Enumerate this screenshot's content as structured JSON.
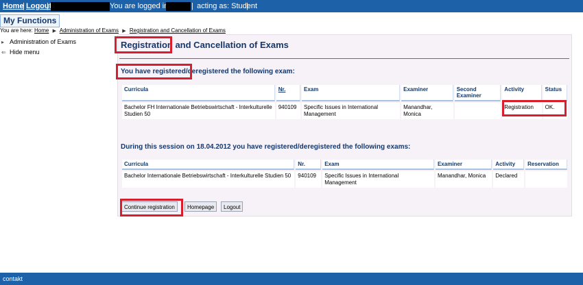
{
  "topbar": {
    "home": "Home",
    "logout": "Logout",
    "logged_in_text": "You are logged in as",
    "acting_as": "acting as: Student"
  },
  "my_functions": "My Functions",
  "breadcrumb": {
    "prefix": "You are here:",
    "items": [
      "Home",
      "Administration of Exams",
      "Registration and Cancellation of Exams"
    ]
  },
  "sidebar": {
    "items": [
      {
        "label": "Administration of Exams",
        "icon": "triangle-right-icon"
      },
      {
        "label": "Hide menu",
        "icon": "arrow-left-icon"
      }
    ]
  },
  "main": {
    "title": "Registration and Cancellation of Exams",
    "confirmation": "You have registered/deregistered the following exam:",
    "session_heading": "During this session on 18.04.2012 you have registered/deregistered the following exams:"
  },
  "table1": {
    "headers": [
      "Curricula",
      "Nr.",
      "Exam",
      "Examiner",
      "Second Examiner",
      "Activity",
      "Status"
    ],
    "row": {
      "curricula": "Bachelor FH Internationale Betriebswirtschaft - Interkulturelle Studien 50",
      "nr": "940109",
      "exam": "Specific Issues in International Management",
      "examiner": "Manandhar, Monica",
      "second_examiner": "",
      "activity": "Registration",
      "status": "OK."
    }
  },
  "table2": {
    "headers": [
      "Curricula",
      "Nr.",
      "Exam",
      "Examiner",
      "Activity",
      "Reservation"
    ],
    "row": {
      "curricula": "Bachelor Internationale Betriebswirtschaft - Interkulturelle Studien 50",
      "nr": "940109",
      "exam": "Specific Issues in International Management",
      "examiner": "Manandhar, Monica",
      "activity": "Declared",
      "reservation": ""
    }
  },
  "buttons": {
    "continue": "Continue registration",
    "homepage": "Homepage",
    "logout": "Logout"
  },
  "footer": "contakt",
  "colors": {
    "bar": "#1d62a8",
    "heading": "#14386b",
    "highlight": "#d81e2c",
    "content_bg": "#f7f1f8"
  }
}
